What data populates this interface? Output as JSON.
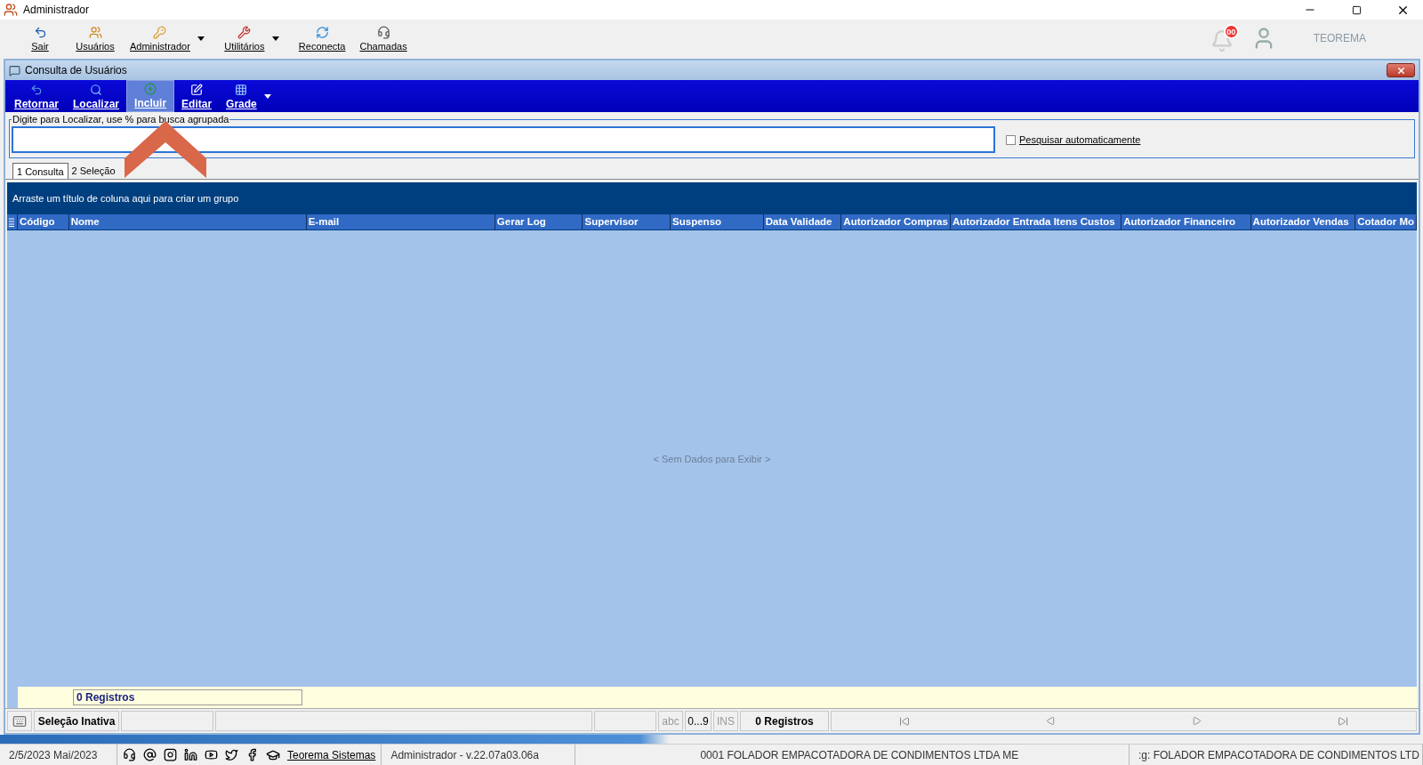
{
  "window": {
    "title": "Administrador"
  },
  "main_toolbar": [
    {
      "label": "Sair",
      "dropdown": false
    },
    {
      "label": "Usuários",
      "dropdown": false
    },
    {
      "label": "Administrador",
      "dropdown": true
    },
    {
      "label": "Utilitários",
      "dropdown": true
    },
    {
      "label": "Reconecta",
      "dropdown": false
    },
    {
      "label": "Chamadas",
      "dropdown": false
    }
  ],
  "notifications": {
    "count": "00"
  },
  "user": {
    "name": "TEOREMA"
  },
  "child_window": {
    "title": "Consulta de Usuários"
  },
  "window_toolbar": [
    {
      "label": "Retornar",
      "selected": false
    },
    {
      "label": "Localizar",
      "selected": false
    },
    {
      "label": "Incluir",
      "selected": true
    },
    {
      "label": "Editar",
      "selected": false
    },
    {
      "label": "Grade",
      "selected": false
    }
  ],
  "search": {
    "label": "Digite para Localizar, use % para busca agrupada",
    "auto_search": {
      "label": "Pesquisar automaticamente",
      "checked": false
    }
  },
  "tabs": [
    {
      "label": "1 Consulta",
      "selected": true
    },
    {
      "label": "2 Seleção",
      "selected": false
    }
  ],
  "group_panel": {
    "hint": "Arraste um título de coluna aqui para criar um grupo"
  },
  "table": {
    "columns": [
      "Código",
      "Nome",
      "E-mail",
      "Gerar Log",
      "Supervisor",
      "Suspenso",
      "Data Validade",
      "Autorizador Compras",
      "Autorizador Entrada Itens Custos",
      "Autorizador Financeiro",
      "Autorizador Vendas",
      "Cotador Mo"
    ],
    "empty_text": "< Sem Dados para Exibir >",
    "footer": "0 Registros"
  },
  "grid_status": {
    "selection": "Seleção Inativa",
    "abc": "abc",
    "digits": "0...9",
    "ins": "INS",
    "records": "0 Registros"
  },
  "status_bar": {
    "date": "2/5/2023 Mai/2023",
    "link": "Teorema Sistemas",
    "user": "Administrador - v.22.07a03.06a",
    "company": "0001 FOLADOR EMPACOTADORA DE CONDIMENTOS LTDA ME",
    "company2": ":g: FOLADOR EMPACOTADORA DE CONDIMENTOS LTD"
  }
}
